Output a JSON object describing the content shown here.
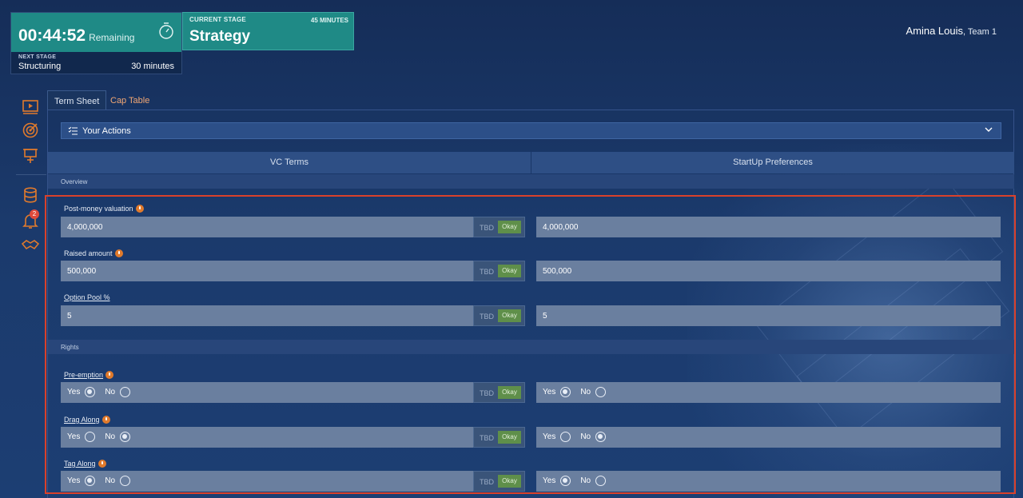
{
  "timer": {
    "clock": "00:44:52",
    "remaining": "Remaining",
    "next_label": "NEXT STAGE",
    "next_stage": "Structuring",
    "next_duration": "30 minutes"
  },
  "stage": {
    "label": "CURRENT STAGE",
    "duration": "45 MINUTES",
    "name": "Strategy"
  },
  "user": {
    "name": "Amina Louis",
    "team": ", Team 1"
  },
  "sidebar": {
    "notification_count": "2"
  },
  "tabs": [
    "Term Sheet",
    "Cap Table"
  ],
  "actions": {
    "label": "Your Actions"
  },
  "columns": [
    "VC Terms",
    "StartUp Preferences"
  ],
  "sections": {
    "overview": "Overview",
    "rights": "Rights"
  },
  "status": {
    "tbd": "TBD",
    "okay": "Okay"
  },
  "fields": [
    {
      "label": "Post-money valuation",
      "vc_value": "4,000,000",
      "startup_value": "4,000,000"
    },
    {
      "label": "Raised amount",
      "vc_value": "500,000",
      "startup_value": "500,000"
    },
    {
      "label": "Option Pool %",
      "vc_value": "5",
      "startup_value": "5"
    }
  ],
  "radio_labels": {
    "yes": "Yes",
    "no": "No"
  },
  "rights": [
    {
      "label": "Pre-emption",
      "vc_choice": "Yes",
      "startup_choice": "Yes"
    },
    {
      "label": "Drag Along",
      "vc_choice": "No",
      "startup_choice": "No"
    },
    {
      "label": "Tag Along",
      "vc_choice": "Yes",
      "startup_choice": "Yes"
    }
  ],
  "colors": {
    "accent_teal": "#1f8a86",
    "highlight_red": "#d9412b",
    "okay_green": "#5f8f4a",
    "icon_orange": "#e07a2c"
  }
}
